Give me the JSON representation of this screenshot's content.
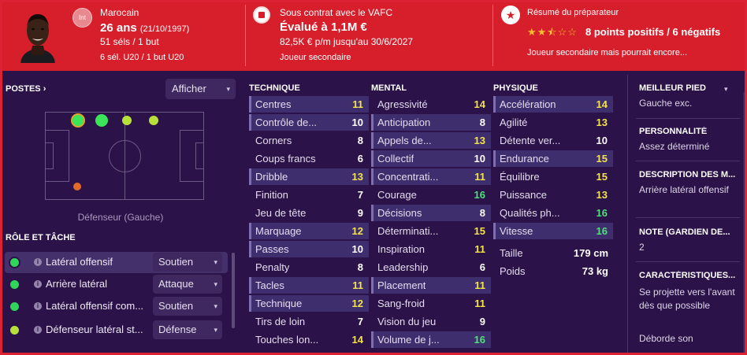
{
  "header": {
    "int_badge": "Int",
    "nationality": "Marocain",
    "age": "26 ans",
    "dob": "(21/10/1997)",
    "career": "51 séls / 1 but",
    "youth": "6 sél. U20 / 1 but U20",
    "contract": "Sous contrat avec le VAFC",
    "value": "Évalué à 1,1M €",
    "wage": "82,5K € p/m jusqu'au 30/6/2027",
    "status": "Joueur secondaire",
    "scout_title": "Résumé du préparateur",
    "stars": "★★⯪☆☆",
    "star_rating": 2.5,
    "scout_summary": "8 points positifs / 6 négatifs",
    "scout_desc": "Joueur secondaire mais pourrait encore..."
  },
  "positions": {
    "title": "POSTES",
    "title_arrow": "›",
    "show_button": "Afficher",
    "caption": "Défenseur (Gauche)"
  },
  "roles": {
    "title": "RÔLE ET TÂCHE",
    "items": [
      {
        "name": "Latéral offensif",
        "duty": "Soutien",
        "dot_color": "#2fd65a"
      },
      {
        "name": "Arrière latéral",
        "duty": "Attaque",
        "dot_color": "#2fd65a"
      },
      {
        "name": "Latéral offensif com...",
        "duty": "Soutien",
        "dot_color": "#2fd65a"
      },
      {
        "name": "Défenseur latéral st...",
        "duty": "Défense",
        "dot_color": "#b8e03a"
      }
    ]
  },
  "attributes": {
    "technique": {
      "title": "TECHNIQUE",
      "rows": [
        {
          "name": "Centres",
          "value": "11",
          "highlight": true
        },
        {
          "name": "Contrôle de...",
          "value": "10",
          "highlight": true
        },
        {
          "name": "Corners",
          "value": "8",
          "highlight": false
        },
        {
          "name": "Coups francs",
          "value": "6",
          "highlight": false
        },
        {
          "name": "Dribble",
          "value": "13",
          "highlight": true
        },
        {
          "name": "Finition",
          "value": "7",
          "highlight": false
        },
        {
          "name": "Jeu de tête",
          "value": "9",
          "highlight": false
        },
        {
          "name": "Marquage",
          "value": "12",
          "highlight": true
        },
        {
          "name": "Passes",
          "value": "10",
          "highlight": true
        },
        {
          "name": "Penalty",
          "value": "8",
          "highlight": false
        },
        {
          "name": "Tacles",
          "value": "11",
          "highlight": true
        },
        {
          "name": "Technique",
          "value": "12",
          "highlight": true
        },
        {
          "name": "Tirs de loin",
          "value": "7",
          "highlight": false
        },
        {
          "name": "Touches lon...",
          "value": "14",
          "highlight": false
        }
      ]
    },
    "mental": {
      "title": "MENTAL",
      "rows": [
        {
          "name": "Agressivité",
          "value": "14",
          "highlight": false
        },
        {
          "name": "Anticipation",
          "value": "8",
          "highlight": true
        },
        {
          "name": "Appels de...",
          "value": "13",
          "highlight": true
        },
        {
          "name": "Collectif",
          "value": "10",
          "highlight": true
        },
        {
          "name": "Concentrati...",
          "value": "11",
          "highlight": true
        },
        {
          "name": "Courage",
          "value": "16",
          "highlight": false
        },
        {
          "name": "Décisions",
          "value": "8",
          "highlight": true
        },
        {
          "name": "Déterminati...",
          "value": "15",
          "highlight": false
        },
        {
          "name": "Inspiration",
          "value": "11",
          "highlight": false
        },
        {
          "name": "Leadership",
          "value": "6",
          "highlight": false
        },
        {
          "name": "Placement",
          "value": "11",
          "highlight": true
        },
        {
          "name": "Sang-froid",
          "value": "11",
          "highlight": false
        },
        {
          "name": "Vision du jeu",
          "value": "9",
          "highlight": false
        },
        {
          "name": "Volume de j...",
          "value": "16",
          "highlight": true
        }
      ]
    },
    "physique": {
      "title": "PHYSIQUE",
      "rows": [
        {
          "name": "Accélération",
          "value": "14",
          "highlight": true
        },
        {
          "name": "Agilité",
          "value": "13",
          "highlight": false
        },
        {
          "name": "Détente ver...",
          "value": "10",
          "highlight": false
        },
        {
          "name": "Endurance",
          "value": "15",
          "highlight": true
        },
        {
          "name": "Équilibre",
          "value": "15",
          "highlight": false
        },
        {
          "name": "Puissance",
          "value": "13",
          "highlight": false
        },
        {
          "name": "Qualités ph...",
          "value": "16",
          "highlight": false
        },
        {
          "name": "Vitesse",
          "value": "16",
          "highlight": true
        }
      ],
      "height_label": "Taille",
      "height_value": "179 cm",
      "weight_label": "Poids",
      "weight_value": "73 kg"
    }
  },
  "details": {
    "foot_title": "MEILLEUR PIED",
    "foot_value": "Gauche exc.",
    "personality_title": "PERSONNALITÉ",
    "personality_value": "Assez déterminé",
    "description_title": "DESCRIPTION DES M...",
    "description_value": "Arrière latéral offensif",
    "gk_title": "NOTE (GARDIEN DE...",
    "gk_value": "2",
    "traits_title": "CARACTÉRISTIQUES...",
    "traits": [
      "Se projette vers l'avant dès que possible",
      "Déborde son"
    ]
  },
  "colors": {
    "header_red": "#d71f2c",
    "panel_purple": "#2b1248",
    "highlight_row": "#3f2e6e",
    "value_white": "#ffffff",
    "value_yellow": "#f2e24c",
    "value_green": "#4fe07a"
  }
}
